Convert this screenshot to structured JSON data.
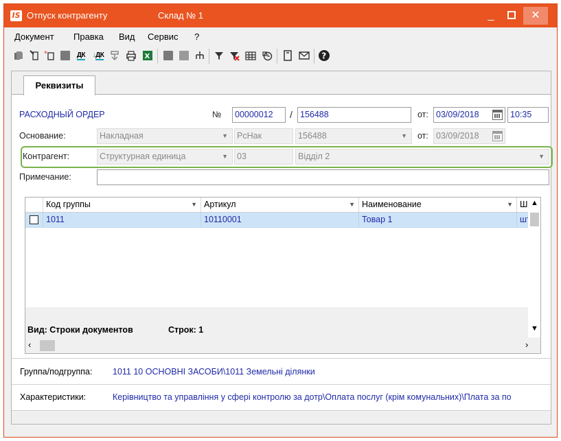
{
  "window": {
    "app_logo": "IS",
    "title": "Отпуск контрагенту",
    "subtitle": "Склад № 1",
    "min_label": "_",
    "close_label": "✕",
    "title_color": "#e95420"
  },
  "menu": {
    "items": [
      "Документ",
      "Правка",
      "Вид",
      "Сервис",
      "?"
    ]
  },
  "toolbar": {
    "icons": [
      "new-doc-icon",
      "edit-doc-icon",
      "new-doc-star-icon",
      "delete-icon",
      "debit-credit-icon",
      "debit-credit-arrow-icon",
      "import-icon",
      "print-icon",
      "excel-icon",
      "save-icon",
      "copy-icon",
      "hierarchy-icon",
      "filter-icon",
      "clear-filter-icon",
      "table-icon",
      "history-icon",
      "note-icon",
      "mail-icon",
      "help-icon"
    ],
    "dk_label": "ДК"
  },
  "tabs": [
    "Реквизиты"
  ],
  "form": {
    "doc_type": "РАСХОДНЫЙ ОРДЕР",
    "no_label": "№",
    "number": "00000012",
    "slash": "/",
    "number2": "156488",
    "from_label": "от:",
    "date": "03/09/2018",
    "time": "10:35",
    "basis_label": "Основание:",
    "basis_type": "Накладная",
    "basis_code": "РсНак",
    "basis_number": "156488",
    "basis_date": "03/09/2018",
    "contractor_label": "Контрагент:",
    "contractor_type": "Структурная единица",
    "contractor_code": "03",
    "contractor_name": "Відділ 2",
    "note_label": "Примечание:",
    "note_value": ""
  },
  "grid": {
    "columns": [
      "Код группы",
      "Артикул",
      "Наименование",
      "Ш"
    ],
    "rows": [
      {
        "code": "1011",
        "article": "10110001",
        "name": "Товар 1",
        "unit": "шт"
      }
    ],
    "view_label": "Вид: Строки документов",
    "rows_label": "Строк: 1"
  },
  "footer": {
    "group_label": "Группа/подгруппа:",
    "group_value": "1011 10 ОСНОВНІ ЗАСОБИ\\1011 Земельні ділянки",
    "char_label": "Характеристики:",
    "char_value": "Керівництво та управління у сфері контролю за дотр\\Оплата послуг (крім комунальних)\\Плата за по"
  },
  "colors": {
    "highlight": "#7ab34a",
    "value_text": "#1f2aa8",
    "selected_row": "#cde3f7"
  }
}
